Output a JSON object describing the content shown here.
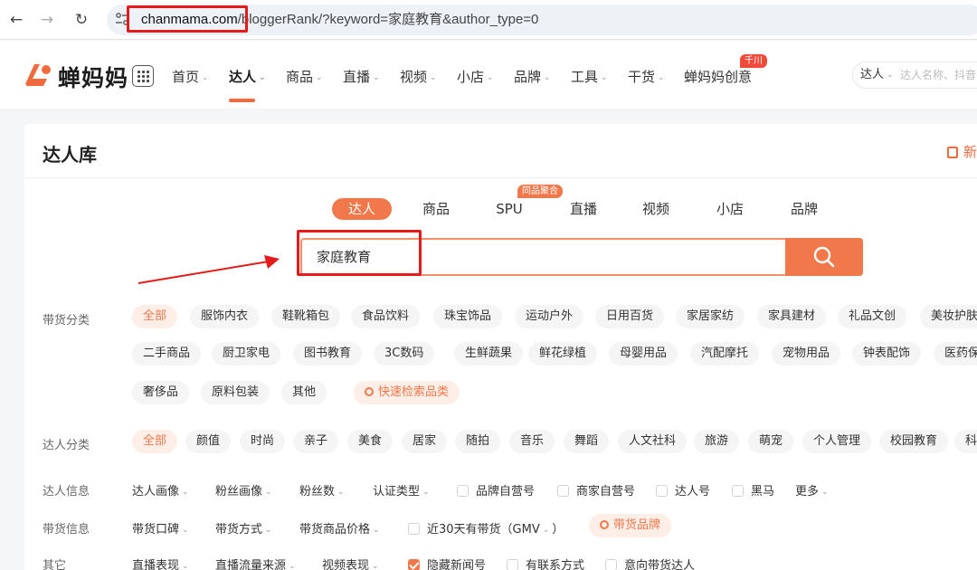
{
  "browser": {
    "url_host": "chanmama.com",
    "url_path": "/bloggerRank/?keyword=家庭教育&author_type=0"
  },
  "header": {
    "logo": "蝉妈妈",
    "menu": [
      {
        "label": "首页",
        "caret": true
      },
      {
        "label": "达人",
        "caret": true
      },
      {
        "label": "商品",
        "caret": true
      },
      {
        "label": "直播",
        "caret": true
      },
      {
        "label": "视频",
        "caret": true
      },
      {
        "label": "小店",
        "caret": true
      },
      {
        "label": "品牌",
        "caret": true
      },
      {
        "label": "工具",
        "caret": true
      },
      {
        "label": "干货",
        "caret": true
      },
      {
        "label": "蝉妈妈创意",
        "caret": false
      }
    ],
    "badge": "千川",
    "search_type": "达人",
    "search_placeholder": "达人名称、抖音"
  },
  "card": {
    "title": "达人库",
    "right_label": "新"
  },
  "search_tabs": [
    "达人",
    "商品",
    "SPU",
    "直播",
    "视频",
    "小店",
    "品牌"
  ],
  "spu_badge": "同品聚合",
  "search": {
    "value": "家庭教育"
  },
  "filters": {
    "goods_label": "带货分类",
    "goods_row1": [
      "全部",
      "服饰内衣",
      "鞋靴箱包",
      "食品饮料",
      "珠宝饰品",
      "运动户外",
      "日用百货",
      "家居家纺",
      "家具建材",
      "礼品文创",
      "美妆护肤"
    ],
    "goods_row2": [
      "二手商品",
      "厨卫家电",
      "图书教育",
      "3C数码",
      "生鲜蔬果",
      "鲜花绿植",
      "母婴用品",
      "汽配摩托",
      "宠物用品",
      "钟表配饰",
      "医药保"
    ],
    "goods_row3": [
      "奢侈品",
      "原料包装",
      "其他"
    ],
    "quick_search": "快速检索品类",
    "author_label": "达人分类",
    "author_row": [
      "全部",
      "颜值",
      "时尚",
      "亲子",
      "美食",
      "居家",
      "随拍",
      "音乐",
      "舞蹈",
      "人文社科",
      "旅游",
      "萌宠",
      "个人管理",
      "校园教育",
      "科"
    ],
    "info_label": "达人信息",
    "info_dropdowns": [
      "达人画像",
      "粉丝画像",
      "粉丝数",
      "认证类型"
    ],
    "info_checks": [
      "品牌自营号",
      "商家自营号",
      "达人号",
      "黑马"
    ],
    "info_more": "更多",
    "sales_label": "带货信息",
    "sales_dropdowns": [
      "带货口碑",
      "带货方式",
      "带货商品价格"
    ],
    "sales_check": "近30天有带货（GMV",
    "sales_check_tail": "）",
    "sales_brand": "带货品牌",
    "other_label": "其它",
    "other_dropdowns": [
      "直播表现",
      "直播流量来源",
      "视频表现"
    ],
    "other_checks": [
      "隐藏新闻号",
      "有联系方式",
      "意向带货达人"
    ]
  }
}
